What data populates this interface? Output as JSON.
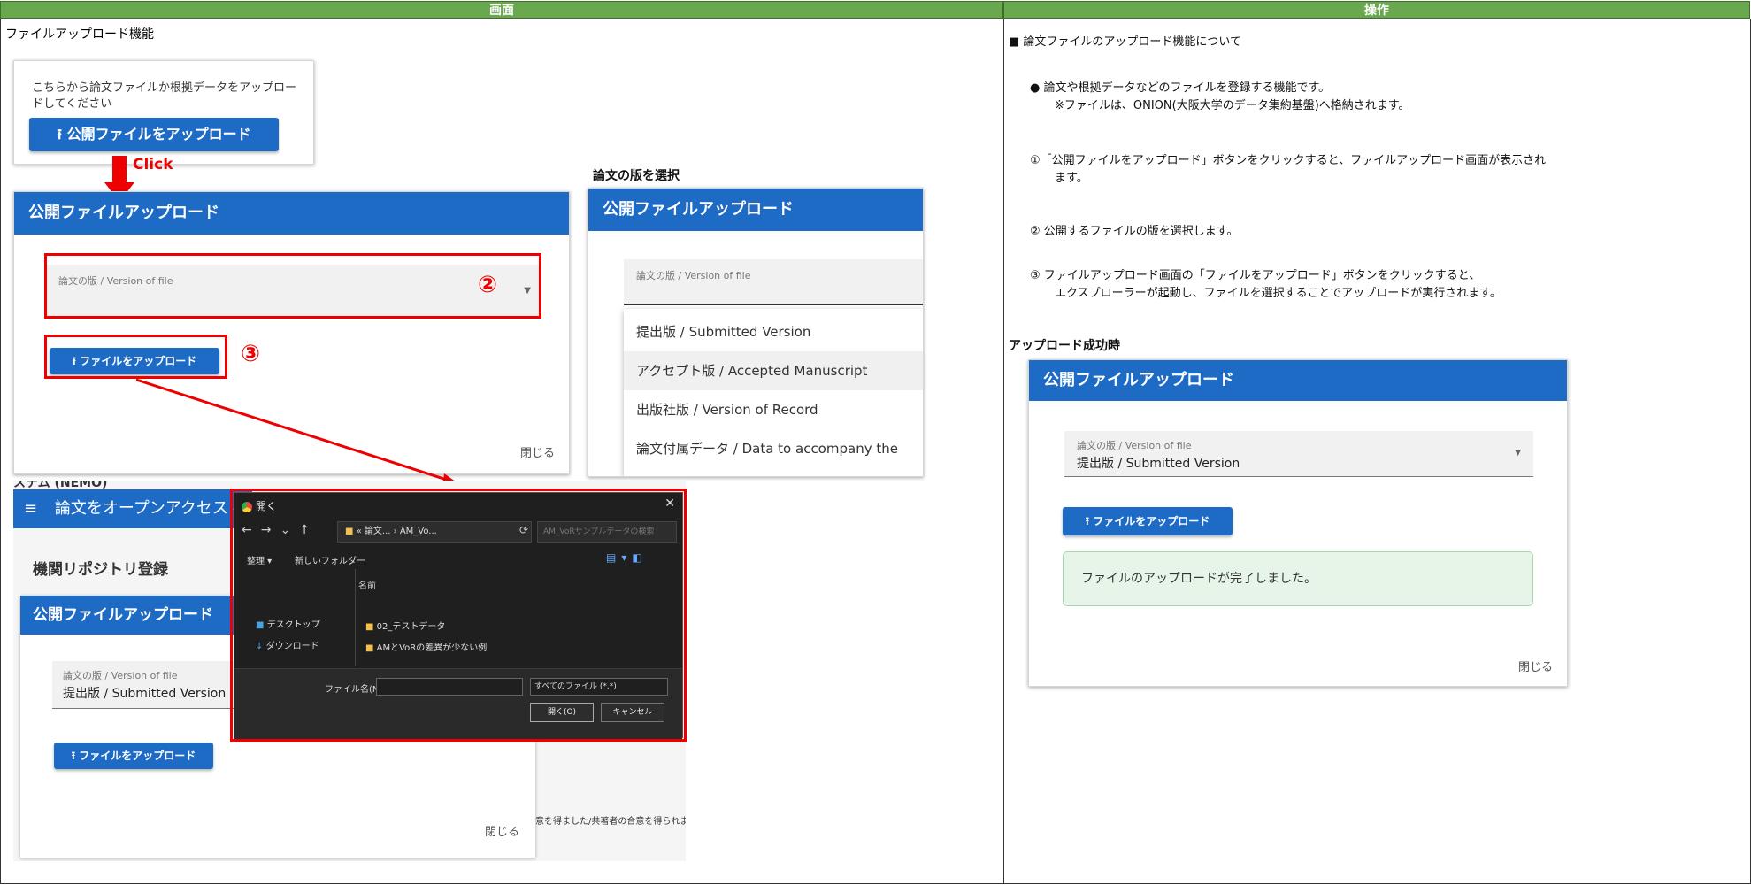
{
  "headers": {
    "screen": "画面",
    "operation": "操作"
  },
  "left": {
    "section_title": "ファイルアップロード機能",
    "card1": {
      "desc": "こちらから論文ファイルか根拠データをアップロードしてください",
      "desc_line1": "こちらから論文ファイルか根拠データをアップロー",
      "desc_line2": "ドしてください",
      "button": "公開ファイルをアップロード"
    },
    "click_label": "Click",
    "dialog1": {
      "title": "公開ファイルアップロード",
      "field_label": "論文の版 / Version of file",
      "marker2": "②",
      "marker3": "③",
      "upload_button": "ファイルをアップロード",
      "close": "閉じる"
    },
    "version_select_caption": "論文の版を選択",
    "dialog2": {
      "title": "公開ファイルアップロード",
      "field_label": "論文の版 / Version of file",
      "options": [
        "提出版 / Submitted Version",
        "アクセプト版 / Accepted Manuscript",
        "出版社版 / Version of Record",
        "論文付属データ / Data to accompany the paper"
      ]
    },
    "background_app": {
      "top_partial": "ステム (NEMO)",
      "nav_title": "論文をオープンアクセスに",
      "page_title": "機関リポジトリ登録",
      "dialog_title": "公開ファイルアップロード",
      "field_label": "論文の版 / Version of file",
      "field_value": "提出版 / Submitted Version",
      "upload_button": "ファイルをアップロード",
      "close": "閉じる",
      "side_text": "意を得ました/共著者の合意を得られま"
    },
    "file_dialog": {
      "title": "開く",
      "path": "« 論文... › AM_Vo...",
      "search_placeholder": "AM_VoRサンプルデータの検索",
      "organize": "整理 ▾",
      "new_folder": "新しいフォルダー",
      "column_name": "名前",
      "nav_items": [
        "デスクトップ",
        "ダウンロード"
      ],
      "files": [
        "02_テストデータ",
        "AMとVoRの差異が少ない例"
      ],
      "filename_label": "ファイル名(N):",
      "filetype": "すべてのファイル (*.*)",
      "open_button": "開く(O)",
      "cancel_button": "キャンセル"
    }
  },
  "right": {
    "heading": "■ 論文ファイルのアップロード機能について",
    "bullet_line1": "● 論文や根拠データなどのファイルを登録する機能です。",
    "bullet_line2": "※ファイルは、ONION(大阪大学のデータ集約基盤)へ格納されます。",
    "step1_line1": "①「公開ファイルをアップロード」ボタンをクリックすると、ファイルアップロード画面が表示され",
    "step1_line2": "ます。",
    "step2": "② 公開するファイルの版を選択します。",
    "step3_line1": "③ ファイルアップロード画面の「ファイルをアップロード」ボタンをクリックすると、",
    "step3_line2": "エクスプローラーが起動し、ファイルを選択することでアップロードが実行されます。",
    "success_caption": "アップロード成功時",
    "success_dialog": {
      "title": "公開ファイルアップロード",
      "field_label": "論文の版 / Version of file",
      "field_value": "提出版 / Submitted Version",
      "upload_button": "ファイルをアップロード",
      "message": "ファイルのアップロードが完了しました。",
      "close": "閉じる"
    }
  },
  "colors": {
    "header_green": "#6aa84f",
    "primary_blue": "#1e6bc6",
    "annotation_red": "#e00000",
    "success_bg": "#e7f5e9"
  }
}
